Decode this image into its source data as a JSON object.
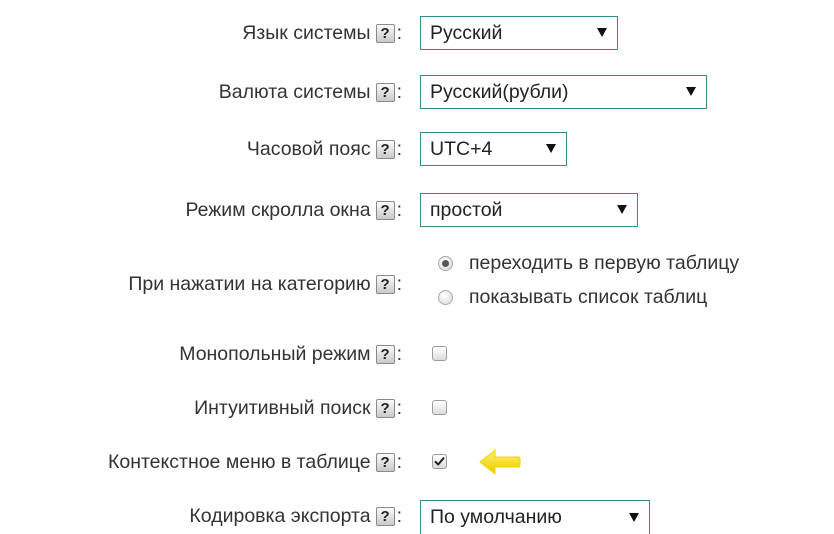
{
  "settings": {
    "language": {
      "label": "Язык системы",
      "value": "Русский"
    },
    "currency": {
      "label": "Валюта системы",
      "value": "Русский(рубли)"
    },
    "timezone": {
      "label": "Часовой пояс",
      "value": "UTC+4"
    },
    "scroll_mode": {
      "label": "Режим скролла окна",
      "value": "простой"
    },
    "category_click": {
      "label": "При нажатии на категорию",
      "options": [
        "переходить в первую таблицу",
        "показывать список таблиц"
      ],
      "selected_index": 0
    },
    "monopole_mode": {
      "label": "Монопольный режим",
      "checked": false
    },
    "intuitive_search": {
      "label": "Интуитивный поиск",
      "checked": false
    },
    "context_menu": {
      "label": "Контекстное меню в таблице",
      "checked": true
    },
    "export_encoding": {
      "label": "Кодировка экспорта",
      "value": "По умолчанию"
    }
  },
  "help_glyph": "?",
  "colon": ":",
  "colors": {
    "select_border": "#3b8a8e",
    "highlight_arrow": "#f5e300"
  },
  "icons": {
    "help": "help-icon",
    "dropdown": "dropdown-arrow-icon",
    "pointer": "yellow-arrow-icon"
  }
}
